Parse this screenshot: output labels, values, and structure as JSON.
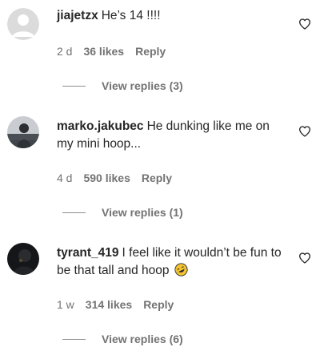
{
  "comments": [
    {
      "username": "jiajetzx",
      "text": "He’s 14 !!!!",
      "age": "2 d",
      "likes": "36 likes",
      "reply_label": "Reply",
      "view_replies": "View replies (3)",
      "avatar": "default-avatar"
    },
    {
      "username": "marko.jakubec",
      "text": "He dunking like me on my mini hoop...",
      "age": "4 d",
      "likes": "590 likes",
      "reply_label": "Reply",
      "view_replies": "View replies (1)",
      "avatar": "photo-avatar"
    },
    {
      "username": "tyrant_419",
      "text": "I feel like it wouldn’t be fun to be that tall and hoop",
      "emoji": "rolling-on-floor-laughing-emoji",
      "age": "1 w",
      "likes": "314 likes",
      "reply_label": "Reply",
      "view_replies": "View replies (6)",
      "avatar": "photo-avatar-dark"
    }
  ],
  "icons": {
    "like": "heart-outline-icon"
  },
  "colors": {
    "text": "#262626",
    "muted": "#737373",
    "divider": "#8e8e8e"
  }
}
